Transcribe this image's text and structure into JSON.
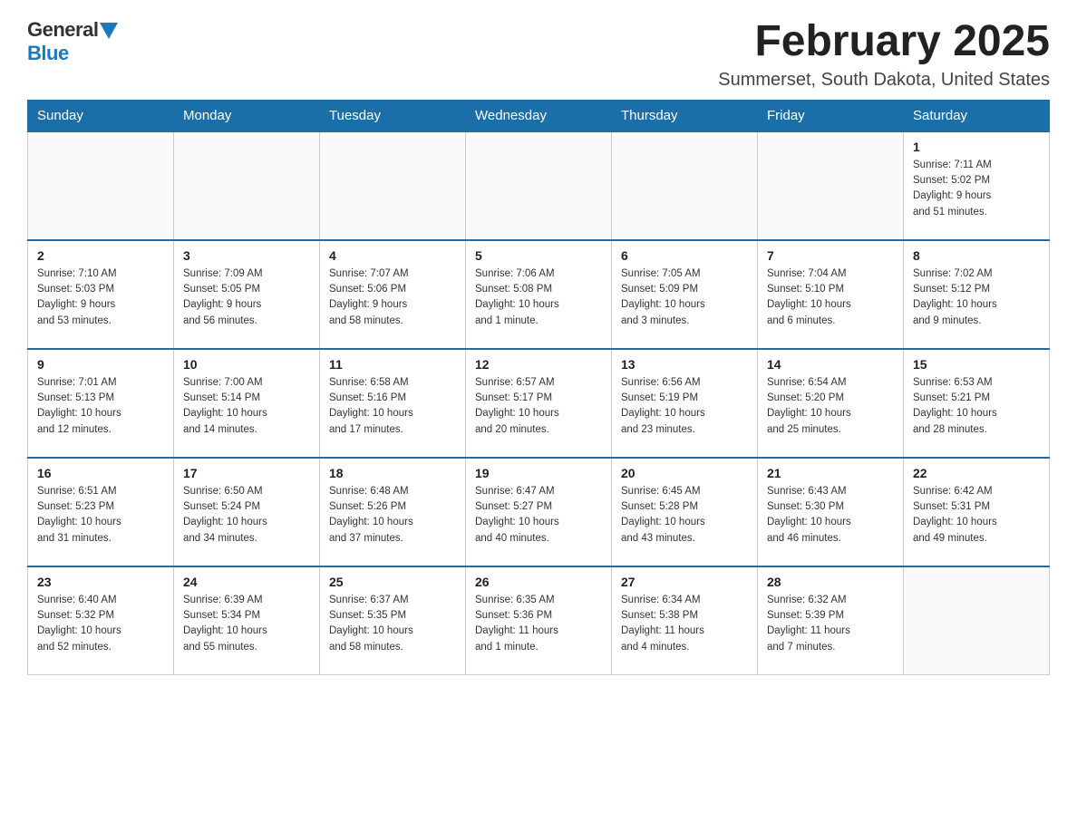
{
  "logo": {
    "general": "General",
    "blue": "Blue"
  },
  "header": {
    "month_year": "February 2025",
    "location": "Summerset, South Dakota, United States"
  },
  "weekdays": [
    "Sunday",
    "Monday",
    "Tuesday",
    "Wednesday",
    "Thursday",
    "Friday",
    "Saturday"
  ],
  "weeks": [
    [
      {
        "day": "",
        "info": ""
      },
      {
        "day": "",
        "info": ""
      },
      {
        "day": "",
        "info": ""
      },
      {
        "day": "",
        "info": ""
      },
      {
        "day": "",
        "info": ""
      },
      {
        "day": "",
        "info": ""
      },
      {
        "day": "1",
        "info": "Sunrise: 7:11 AM\nSunset: 5:02 PM\nDaylight: 9 hours\nand 51 minutes."
      }
    ],
    [
      {
        "day": "2",
        "info": "Sunrise: 7:10 AM\nSunset: 5:03 PM\nDaylight: 9 hours\nand 53 minutes."
      },
      {
        "day": "3",
        "info": "Sunrise: 7:09 AM\nSunset: 5:05 PM\nDaylight: 9 hours\nand 56 minutes."
      },
      {
        "day": "4",
        "info": "Sunrise: 7:07 AM\nSunset: 5:06 PM\nDaylight: 9 hours\nand 58 minutes."
      },
      {
        "day": "5",
        "info": "Sunrise: 7:06 AM\nSunset: 5:08 PM\nDaylight: 10 hours\nand 1 minute."
      },
      {
        "day": "6",
        "info": "Sunrise: 7:05 AM\nSunset: 5:09 PM\nDaylight: 10 hours\nand 3 minutes."
      },
      {
        "day": "7",
        "info": "Sunrise: 7:04 AM\nSunset: 5:10 PM\nDaylight: 10 hours\nand 6 minutes."
      },
      {
        "day": "8",
        "info": "Sunrise: 7:02 AM\nSunset: 5:12 PM\nDaylight: 10 hours\nand 9 minutes."
      }
    ],
    [
      {
        "day": "9",
        "info": "Sunrise: 7:01 AM\nSunset: 5:13 PM\nDaylight: 10 hours\nand 12 minutes."
      },
      {
        "day": "10",
        "info": "Sunrise: 7:00 AM\nSunset: 5:14 PM\nDaylight: 10 hours\nand 14 minutes."
      },
      {
        "day": "11",
        "info": "Sunrise: 6:58 AM\nSunset: 5:16 PM\nDaylight: 10 hours\nand 17 minutes."
      },
      {
        "day": "12",
        "info": "Sunrise: 6:57 AM\nSunset: 5:17 PM\nDaylight: 10 hours\nand 20 minutes."
      },
      {
        "day": "13",
        "info": "Sunrise: 6:56 AM\nSunset: 5:19 PM\nDaylight: 10 hours\nand 23 minutes."
      },
      {
        "day": "14",
        "info": "Sunrise: 6:54 AM\nSunset: 5:20 PM\nDaylight: 10 hours\nand 25 minutes."
      },
      {
        "day": "15",
        "info": "Sunrise: 6:53 AM\nSunset: 5:21 PM\nDaylight: 10 hours\nand 28 minutes."
      }
    ],
    [
      {
        "day": "16",
        "info": "Sunrise: 6:51 AM\nSunset: 5:23 PM\nDaylight: 10 hours\nand 31 minutes."
      },
      {
        "day": "17",
        "info": "Sunrise: 6:50 AM\nSunset: 5:24 PM\nDaylight: 10 hours\nand 34 minutes."
      },
      {
        "day": "18",
        "info": "Sunrise: 6:48 AM\nSunset: 5:26 PM\nDaylight: 10 hours\nand 37 minutes."
      },
      {
        "day": "19",
        "info": "Sunrise: 6:47 AM\nSunset: 5:27 PM\nDaylight: 10 hours\nand 40 minutes."
      },
      {
        "day": "20",
        "info": "Sunrise: 6:45 AM\nSunset: 5:28 PM\nDaylight: 10 hours\nand 43 minutes."
      },
      {
        "day": "21",
        "info": "Sunrise: 6:43 AM\nSunset: 5:30 PM\nDaylight: 10 hours\nand 46 minutes."
      },
      {
        "day": "22",
        "info": "Sunrise: 6:42 AM\nSunset: 5:31 PM\nDaylight: 10 hours\nand 49 minutes."
      }
    ],
    [
      {
        "day": "23",
        "info": "Sunrise: 6:40 AM\nSunset: 5:32 PM\nDaylight: 10 hours\nand 52 minutes."
      },
      {
        "day": "24",
        "info": "Sunrise: 6:39 AM\nSunset: 5:34 PM\nDaylight: 10 hours\nand 55 minutes."
      },
      {
        "day": "25",
        "info": "Sunrise: 6:37 AM\nSunset: 5:35 PM\nDaylight: 10 hours\nand 58 minutes."
      },
      {
        "day": "26",
        "info": "Sunrise: 6:35 AM\nSunset: 5:36 PM\nDaylight: 11 hours\nand 1 minute."
      },
      {
        "day": "27",
        "info": "Sunrise: 6:34 AM\nSunset: 5:38 PM\nDaylight: 11 hours\nand 4 minutes."
      },
      {
        "day": "28",
        "info": "Sunrise: 6:32 AM\nSunset: 5:39 PM\nDaylight: 11 hours\nand 7 minutes."
      },
      {
        "day": "",
        "info": ""
      }
    ]
  ]
}
